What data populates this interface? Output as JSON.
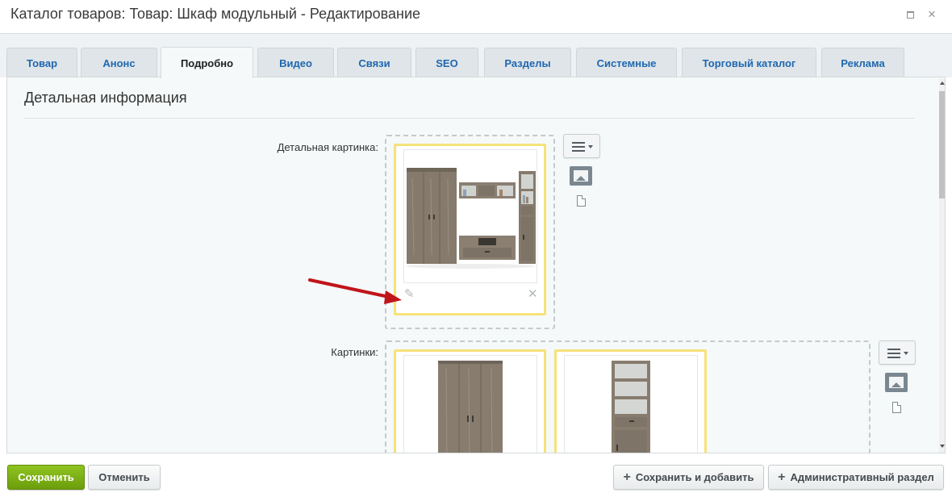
{
  "window": {
    "title": "Каталог товаров: Товар: Шкаф модульный - Редактирование",
    "maximize_icon": "maximize-icon",
    "close_icon": "close-icon",
    "close_glyph": "×"
  },
  "tabs": [
    {
      "label": "Товар",
      "active": false
    },
    {
      "label": "Анонс",
      "active": false
    },
    {
      "label": "Подробно",
      "active": true
    },
    {
      "label": "Видео",
      "active": false
    },
    {
      "label": "Связи",
      "active": false
    },
    {
      "label": "SEO",
      "active": false
    },
    {
      "label": "Разделы",
      "active": false
    },
    {
      "label": "Системные",
      "active": false
    },
    {
      "label": "Торговый каталог",
      "active": false
    },
    {
      "label": "Реклама",
      "active": false
    }
  ],
  "section": {
    "title": "Детальная информация"
  },
  "detail_picture": {
    "label": "Детальная картинка:",
    "edit_icon": "pencil-icon",
    "delete_icon": "close-icon",
    "edit_glyph": "✎",
    "delete_glyph": "✕"
  },
  "pictures": {
    "label": "Картинки:"
  },
  "side_menu": {
    "menu_icon": "menu-icon",
    "image_icon": "image-icon",
    "file_icon": "file-icon"
  },
  "annotation": {
    "arrow_color": "#c0151a"
  },
  "footer": {
    "save_label": "Сохранить",
    "cancel_label": "Отменить",
    "save_add_label": "Сохранить и добавить",
    "admin_section_label": "Административный раздел",
    "plus_glyph": "+"
  },
  "colors": {
    "accent_green": "#7ab317",
    "tab_link": "#2067b0",
    "card_border": "#f6e27a"
  }
}
